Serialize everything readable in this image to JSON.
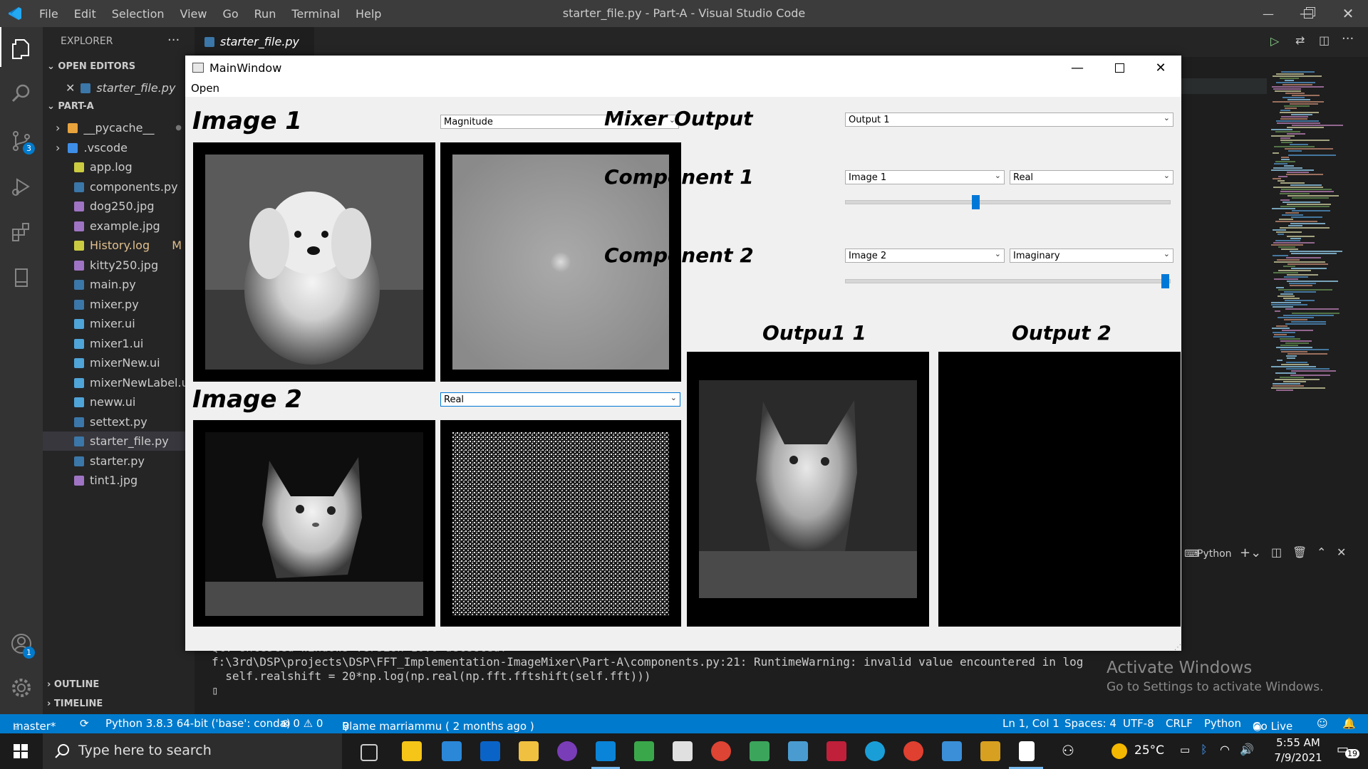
{
  "vscode": {
    "menu": [
      "File",
      "Edit",
      "Selection",
      "View",
      "Go",
      "Run",
      "Terminal",
      "Help"
    ],
    "title": "starter_file.py - Part-A - Visual Studio Code",
    "explorer_label": "EXPLORER",
    "open_editors_label": "OPEN EDITORS",
    "open_editor_file": "starter_file.py",
    "folder_label": "PART-A",
    "files": [
      {
        "name": "__pycache__",
        "kind": "folder",
        "color": "#e8a33d"
      },
      {
        "name": ".vscode",
        "kind": "folder",
        "color": "#3e8ee8"
      },
      {
        "name": "app.log",
        "kind": "log",
        "color": "#cbcb41"
      },
      {
        "name": "components.py",
        "kind": "py",
        "color": "#3b77a8"
      },
      {
        "name": "dog250.jpg",
        "kind": "img",
        "color": "#a074c4"
      },
      {
        "name": "example.jpg",
        "kind": "img",
        "color": "#a074c4"
      },
      {
        "name": "History.log",
        "kind": "log",
        "color": "#cbcb41",
        "badge": "M"
      },
      {
        "name": "kitty250.jpg",
        "kind": "img",
        "color": "#a074c4"
      },
      {
        "name": "main.py",
        "kind": "py",
        "color": "#3b77a8"
      },
      {
        "name": "mixer.py",
        "kind": "py",
        "color": "#3b77a8"
      },
      {
        "name": "mixer.ui",
        "kind": "ui",
        "color": "#4fa4d8"
      },
      {
        "name": "mixer1.ui",
        "kind": "ui",
        "color": "#4fa4d8"
      },
      {
        "name": "mixerNew.ui",
        "kind": "ui",
        "color": "#4fa4d8"
      },
      {
        "name": "mixerNewLabel.ui",
        "kind": "ui",
        "color": "#4fa4d8"
      },
      {
        "name": "neww.ui",
        "kind": "ui",
        "color": "#4fa4d8"
      },
      {
        "name": "settext.py",
        "kind": "py",
        "color": "#3b77a8"
      },
      {
        "name": "starter_file.py",
        "kind": "py",
        "color": "#3b77a8",
        "selected": true
      },
      {
        "name": "starter.py",
        "kind": "py",
        "color": "#3b77a8"
      },
      {
        "name": "tint1.jpg",
        "kind": "img",
        "color": "#a074c4"
      }
    ],
    "outline_label": "OUTLINE",
    "timeline_label": "TIMELINE",
    "tab_label": "starter_file.py",
    "terminal_lines": [
      "Qt: Untested Windows version 10.0 detected!",
      "f:\\3rd\\DSP\\projects\\DSP\\FFT_Implementation-ImageMixer\\Part-A\\components.py:21: RuntimeWarning: invalid value encountered in log",
      "  self.realshift = 20*np.log(np.real(np.fft.fftshift(self.fft)))",
      "▯"
    ],
    "terminal_panel_label": "Python",
    "activate_title": "Activate Windows",
    "activate_sub": "Go to Settings to activate Windows.",
    "badges": {
      "source_control": "3",
      "accounts": "1"
    },
    "status": {
      "branch": "master*",
      "python": "Python 3.8.3 64-bit ('base': conda)",
      "problems": "⊗ 0 ⚠ 0",
      "blame": "Blame marriammu ( 2 months ago )",
      "position": "Ln 1, Col 1",
      "spaces": "Spaces: 4",
      "encoding": "UTF-8",
      "eol": "CRLF",
      "language": "Python",
      "golive": "Go Live"
    }
  },
  "mainwindow": {
    "title": "MainWindow",
    "menu_open": "Open",
    "image1_label": "Image 1",
    "image1_combo": "Magnitude",
    "image2_label": "Image 2",
    "image2_combo": "Real",
    "mixer_output_label": "Mixer Output",
    "mixer_output_combo": "Output 1",
    "component1_label": "Component 1",
    "component1_image": "Image 1",
    "component1_type": "Real",
    "component1_slider": 0.4,
    "component2_label": "Component 2",
    "component2_image": "Image 2",
    "component2_type": "Imaginary",
    "component2_slider": 1.0,
    "output1_label": "Outpu1 1",
    "output2_label": "Output 2"
  },
  "taskbar": {
    "search_placeholder": "Type here to search",
    "weather": "25°C",
    "time": "5:55 AM",
    "date": "7/9/2021",
    "notifications": "19"
  },
  "colors": {
    "accent": "#007acc",
    "qt_accent": "#0078d7"
  }
}
